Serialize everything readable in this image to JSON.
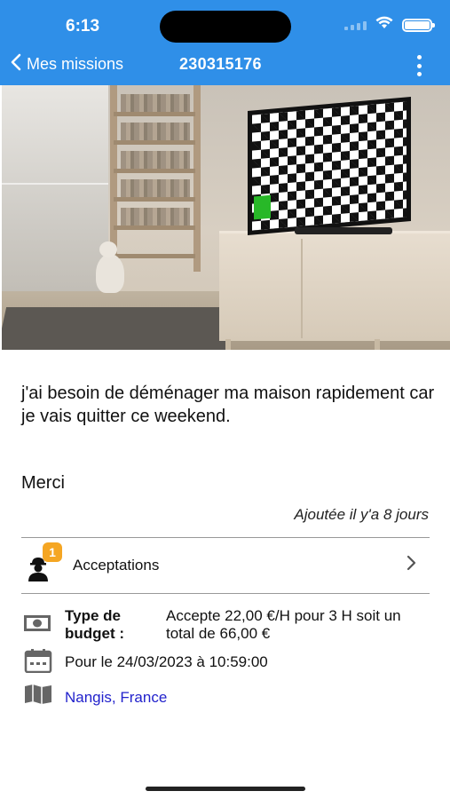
{
  "status_bar": {
    "time": "6:13"
  },
  "nav": {
    "back_label": "Mes missions",
    "title": "230315176",
    "back_icon": "chevron-left-icon",
    "more_icon": "more-vertical-icon"
  },
  "colors": {
    "header_bg": "#2f8fe8",
    "badge": "#f5a623",
    "link": "#2222cc"
  },
  "mission": {
    "description": "j'ai besoin de déménager ma maison rapidement car je vais quitter ce weekend.",
    "closing": "Merci",
    "added": "Ajoutée il y'a 8 jours"
  },
  "acceptations": {
    "label": "Acceptations",
    "count": "1",
    "icon": "worker-icon"
  },
  "details": {
    "budget_label": "Type de budget :",
    "budget_value": "Accepte 22,00 €/H pour 3 H soit un total de 66,00 €",
    "date_value": "Pour le 24/03/2023 à 10:59:00",
    "location": "Nangis, France"
  }
}
